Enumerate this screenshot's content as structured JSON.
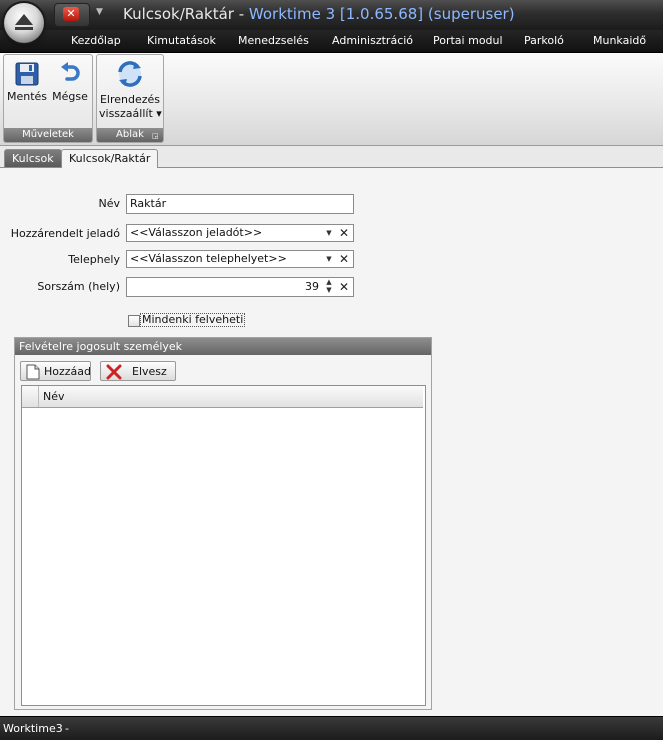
{
  "window": {
    "title_doc": "Kulcsok/Raktár",
    "title_sep": " - ",
    "title_app": "Worktime 3 [1.0.65.68] (superuser)"
  },
  "menu": {
    "items": [
      "Kezdőlap",
      "Kimutatások",
      "Menedzselés",
      "Adminisztráció",
      "Portai modul",
      "Parkoló",
      "Munkaidő"
    ]
  },
  "ribbon": {
    "groups": [
      {
        "name": "Műveletek",
        "buttons": [
          "Mentés",
          "Mégse"
        ]
      },
      {
        "name": "Ablak",
        "buttons": [
          "Elrendezés visszaállít"
        ]
      }
    ],
    "layout_btn_line1": "Elrendezés",
    "layout_btn_line2": "visszaállít",
    "dropdown_arrow": "▾"
  },
  "tabs": [
    "Kulcsok",
    "Kulcsok/Raktár"
  ],
  "form": {
    "name_label": "Név",
    "name_value": "Raktár",
    "assigned_label": "Hozzárendelt jeladó",
    "assigned_value": "<<Válasszon jeladót>>",
    "site_label": "Telephely",
    "site_value": "<<Válasszon telephelyet>>",
    "seq_label": "Sorszám (hely)",
    "seq_value": "39",
    "everyone_label": "Mindenki felveheti",
    "everyone_checked": false
  },
  "persons_group": {
    "title": "Felvételre jogosult személyek",
    "add_label": "Hozzáad",
    "remove_label": "Elvesz",
    "columns": [
      "Név"
    ],
    "rows": []
  },
  "statusbar": {
    "app": "Worktime3",
    "sep": "-"
  },
  "colors": {
    "title_accent": "#8eb8ff",
    "close_red": "#d42a1c",
    "remove_red": "#cc2222"
  },
  "icons": {
    "save": "floppy-disk-icon",
    "cancel": "undo-arrow-icon",
    "layout": "refresh-icon",
    "add": "new-document-icon",
    "remove": "red-x-icon"
  }
}
